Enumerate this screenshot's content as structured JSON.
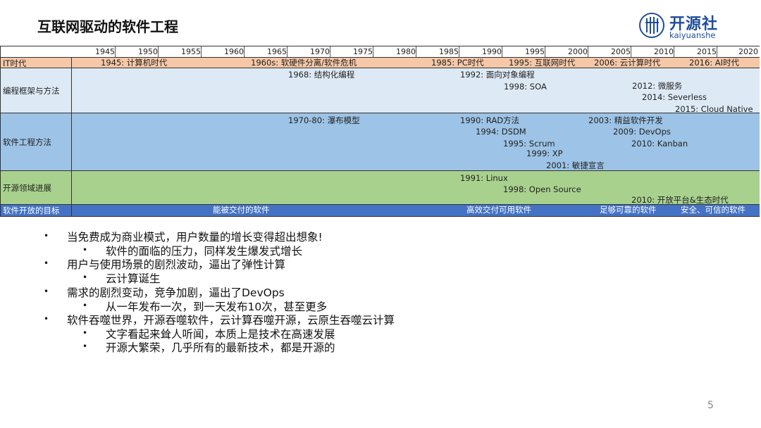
{
  "title": "互联网驱动的软件工程",
  "logo": {
    "cn": "开源社",
    "en": "kaiyuanshe",
    "icon": "kaiyuanshe-logo-icon",
    "color": "#1f4e99"
  },
  "years": [
    "1945",
    "1950",
    "1955",
    "1960",
    "1965",
    "1970",
    "1975",
    "1980",
    "1985",
    "1990",
    "1995",
    "2000",
    "2005",
    "2010",
    "2015",
    "2020"
  ],
  "rows": {
    "it": {
      "label": "IT时代",
      "color": "#f6c8a8",
      "events": [
        "1945: 计算机时代",
        "1960s: 软硬件分离/软件危机",
        "1985: PC时代",
        "1995: 互联网时代",
        "2006: 云计算时代",
        "2016: AI时代"
      ]
    },
    "framework": {
      "label": "编程框架与方法",
      "color": "#ddeaf6",
      "events": [
        "1968: 结构化编程",
        "1992: 面向对象编程",
        "1998: SOA",
        "2012: 微服务",
        "2014: Severless",
        "2015: Cloud Native"
      ]
    },
    "method": {
      "label": "软件工程方法",
      "color": "#9dc3e6",
      "events": [
        "1970-80: 瀑布模型",
        "1990: RAD方法",
        "1994: DSDM",
        "1995: Scrum",
        "1999: XP",
        "2001: 敏捷宣言",
        "2003: 精益软件开发",
        "2009: DevOps",
        "2010: Kanban"
      ]
    },
    "opensource": {
      "label": "开源领域进展",
      "color": "#a9d18e",
      "events": [
        "1991: Linux",
        "1998: Open Source",
        "2010: 开放平台&生态时代"
      ]
    },
    "goal": {
      "label": "软件开放的目标",
      "color": "#4472c4",
      "events": [
        "能被交付的软件",
        "高效交付可用软件",
        "足够可靠的软件",
        "安全、可信的软件"
      ]
    }
  },
  "bullets": [
    "当免费成为商业模式，用户数量的增长变得超出想象!",
    "软件的面临的压力，同样发生爆发式增长",
    "用户与使用场景的剧烈波动，逼出了弹性计算",
    "云计算诞生",
    "需求的剧烈变动，竞争加剧，逼出了DevOps",
    "从一年发布一次，到一天发布10次，甚至更多",
    "软件吞噬世界，开源吞噬软件，云计算吞噬开源，云原生吞噬云计算",
    "文字看起来耸人听闻，本质上是技术在高速发展",
    "开源大繁荣，几乎所有的最新技术，都是开源的"
  ],
  "bullet_marks": {
    "level1": "•",
    "level2": "•"
  },
  "page_number": "5"
}
